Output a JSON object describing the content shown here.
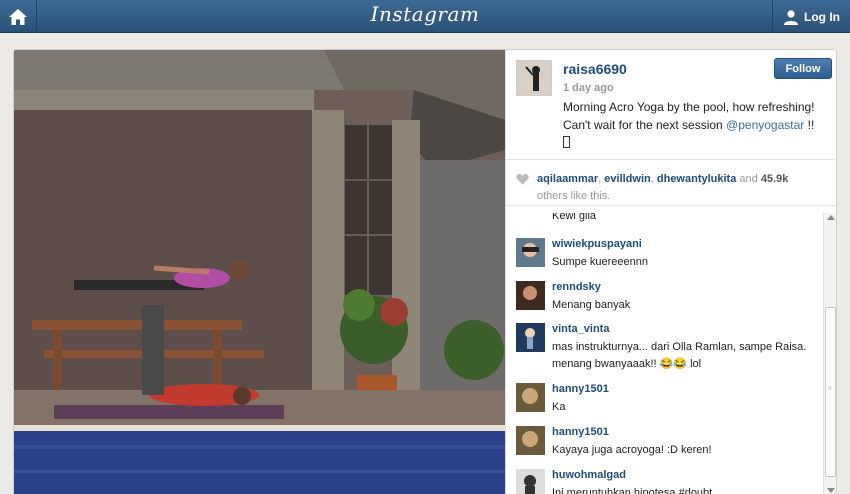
{
  "header": {
    "brand": "Instagram",
    "login_label": "Log In"
  },
  "post": {
    "username": "raisa6690",
    "time": "1 day ago",
    "caption": "Morning Acro Yoga by the pool, how refreshing! Can't wait for the next session ",
    "caption_tag": "@penyogastar",
    "caption_end": " !!",
    "follow_label": "Follow"
  },
  "likes": {
    "users": [
      "aqilaammar",
      "evilldwin",
      "dhewantylukita"
    ],
    "sep1": ", ",
    "sep2": ", ",
    "and_text": " and ",
    "count": "45.9k",
    "suffix": " others like this."
  },
  "comments": [
    {
      "user": "",
      "text": "Kewl gila"
    },
    {
      "user": "wiwiekpuspayani",
      "text": "Sumpe kuereeennn"
    },
    {
      "user": "renndsky",
      "text": "Menang banyak"
    },
    {
      "user": "vinta_vinta",
      "text": "mas instrukturnya... dari Olla Ramlan, sampe Raisa. menang bwanyaaak!! 😂😂 lol"
    },
    {
      "user": "hanny1501",
      "text": "Ka"
    },
    {
      "user": "hanny1501",
      "text": "Kayaya juga acroyoga! :D keren!"
    },
    {
      "user": "huwohmalgad",
      "text": "Ini meruntuhkan hipotesa #doubt"
    }
  ],
  "colors": {
    "topbar": "#2f5a84",
    "link": "#1f4c7a",
    "follow": "#3a6a9c"
  },
  "icons": {
    "home": "home-icon",
    "login": "user-icon",
    "like": "heart-icon"
  }
}
